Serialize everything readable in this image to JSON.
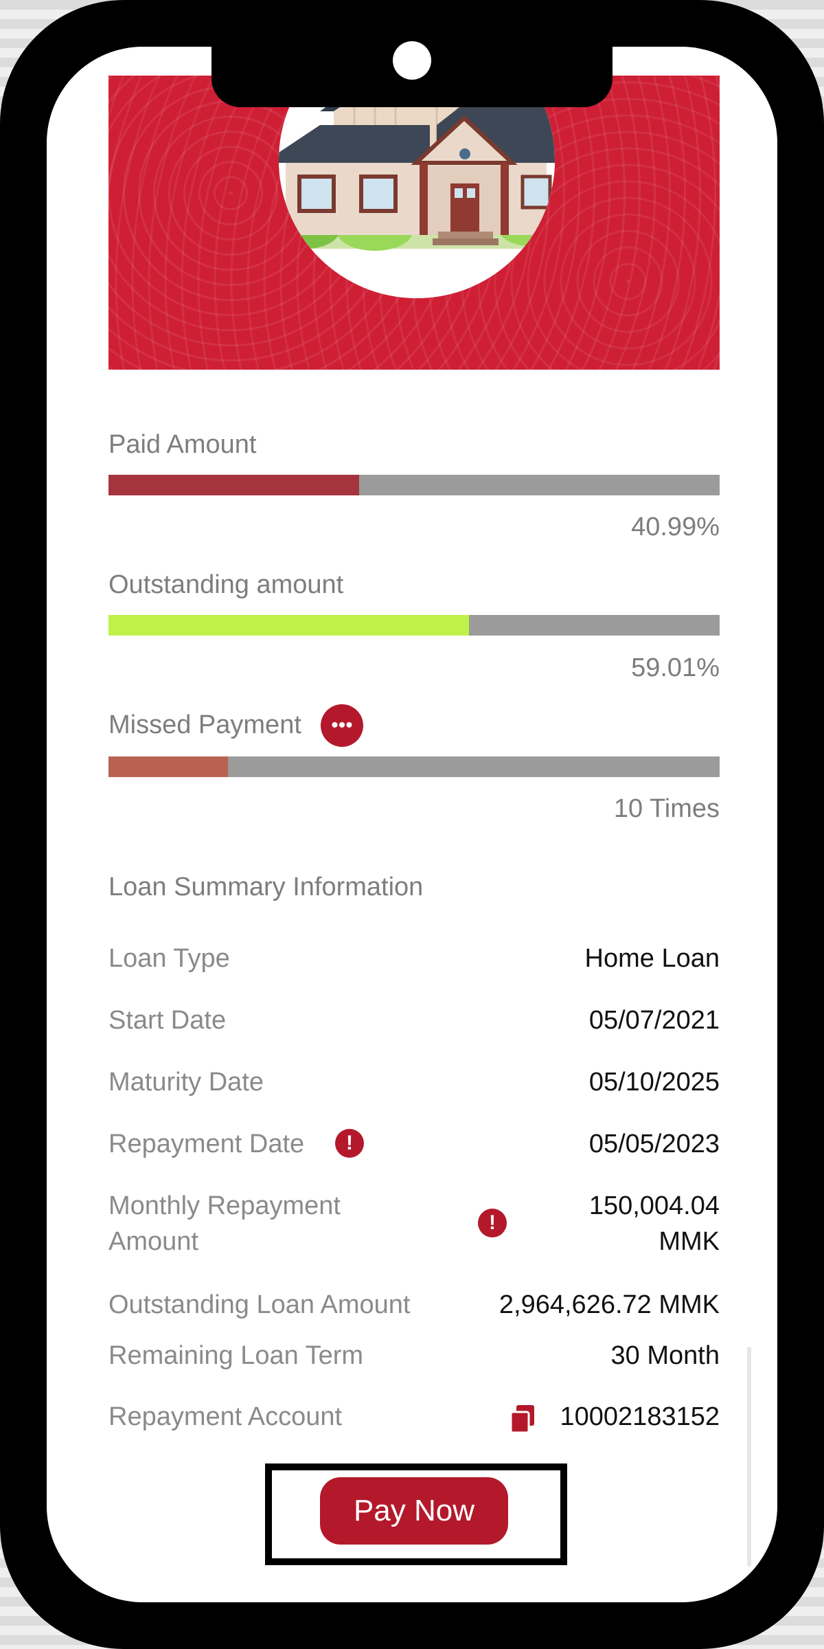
{
  "hero": {
    "image": "house-illustration"
  },
  "progress": {
    "paid": {
      "label": "Paid Amount",
      "value_text": "40.99%",
      "fraction": 0.4099,
      "color": "#a5343e"
    },
    "outstanding": {
      "label": "Outstanding amount",
      "value_text": "59.01%",
      "fraction": 0.5901,
      "color": "#bff248"
    },
    "missed": {
      "label": "Missed Payment",
      "value_text": "10 Times",
      "fraction": 0.196,
      "color": "#b96252"
    }
  },
  "summary": {
    "title": "Loan Summary Information",
    "loan_type": {
      "label": "Loan Type",
      "value": "Home Loan"
    },
    "start_date": {
      "label": "Start Date",
      "value": "05/07/2021"
    },
    "maturity_date": {
      "label": "Maturity Date",
      "value": "05/10/2025"
    },
    "repayment_date": {
      "label": "Repayment Date",
      "value": "05/05/2023"
    },
    "monthly_repayment": {
      "label_line1": "Monthly Repayment",
      "label_line2": "Amount",
      "value_line1": "150,004.04",
      "value_line2": "MMK"
    },
    "outstanding_loan": {
      "label": "Outstanding Loan Amount",
      "value": "2,964,626.72 MMK"
    },
    "remaining_term": {
      "label": "Remaining Loan Term",
      "value": "30 Month"
    },
    "repayment_account": {
      "label": "Repayment Account",
      "value": "10002183152"
    }
  },
  "actions": {
    "pay_now": "Pay Now"
  },
  "colors": {
    "accent": "#b3192b",
    "hero_red": "#cf1f35",
    "track": "#9b9b9b"
  }
}
